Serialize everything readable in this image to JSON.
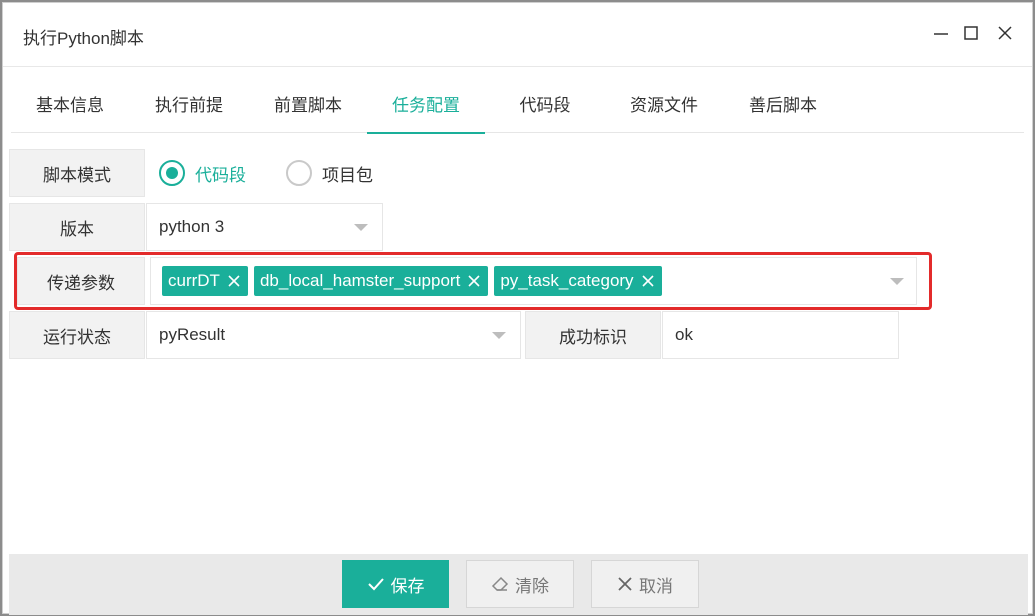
{
  "window": {
    "title": "执行Python脚本",
    "minimize_icon": "minimize-icon",
    "maximize_icon": "maximize-icon",
    "close_icon": "close-icon"
  },
  "tabs": [
    {
      "label": "基本信息",
      "active": false
    },
    {
      "label": "执行前提",
      "active": false
    },
    {
      "label": "前置脚本",
      "active": false
    },
    {
      "label": "任务配置",
      "active": true
    },
    {
      "label": "代码段",
      "active": false
    },
    {
      "label": "资源文件",
      "active": false
    },
    {
      "label": "善后脚本",
      "active": false
    }
  ],
  "form": {
    "script_mode": {
      "label": "脚本模式",
      "options": [
        {
          "label": "代码段",
          "checked": true
        },
        {
          "label": "项目包",
          "checked": false
        }
      ]
    },
    "version": {
      "label": "版本",
      "value": "python 3"
    },
    "params": {
      "label": "传递参数",
      "tags": [
        "currDT",
        "db_local_hamster_support",
        "py_task_category"
      ]
    },
    "run_status": {
      "label": "运行状态",
      "value": "pyResult"
    },
    "success_flag": {
      "label": "成功标识",
      "value": "ok"
    }
  },
  "footer": {
    "save_label": "保存",
    "clear_label": "清除",
    "cancel_label": "取消"
  },
  "colors": {
    "accent": "#1aaf9a",
    "highlight": "#e32b2b"
  }
}
